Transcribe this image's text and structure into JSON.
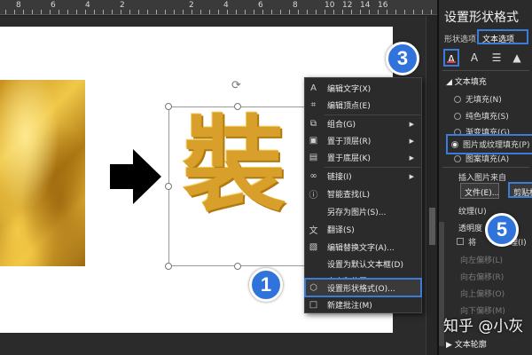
{
  "ruler": {
    "labels": [
      "8",
      "6",
      "4",
      "2",
      "2",
      "4",
      "6",
      "8",
      "10",
      "12",
      "14",
      "16"
    ]
  },
  "colors": {
    "accent": "#3b7bd9",
    "badge": "#2f73db",
    "gold": "#d8a02a"
  },
  "canvas": {
    "text_char": "裝"
  },
  "context_menu": {
    "items": [
      {
        "label": "编辑文字(X)",
        "icon": "edit-text-icon",
        "glyph": "A"
      },
      {
        "label": "编辑顶点(E)",
        "icon": "edit-points-icon",
        "glyph": "⌗"
      },
      {
        "label": "组合(G)",
        "icon": "group-icon",
        "glyph": "⧉",
        "submenu": true
      },
      {
        "label": "置于顶层(R)",
        "icon": "bring-to-front-icon",
        "glyph": "▣",
        "submenu": true
      },
      {
        "label": "置于底层(K)",
        "icon": "send-to-back-icon",
        "glyph": "▤",
        "submenu": true
      },
      {
        "label": "链接(I)",
        "icon": "link-icon",
        "glyph": "∞",
        "submenu": true
      },
      {
        "label": "智能查找(L)",
        "icon": "smart-lookup-icon",
        "glyph": "ⓘ"
      },
      {
        "label": "另存为图片(S)...",
        "icon": "save-as-picture-icon",
        "glyph": ""
      },
      {
        "label": "翻译(S)",
        "icon": "translate-icon",
        "glyph": "文"
      },
      {
        "label": "编辑替换文字(A)...",
        "icon": "alt-text-icon",
        "glyph": "▧"
      },
      {
        "label": "设置为默认文本框(D)",
        "icon": "default-textbox-icon",
        "glyph": ""
      },
      {
        "label": "大小和位置(Z)...",
        "icon": "size-position-icon",
        "glyph": "⌐"
      },
      {
        "label": "设置形状格式(O)...",
        "icon": "format-shape-icon",
        "glyph": "⬡"
      },
      {
        "label": "新建批注(M)",
        "icon": "new-comment-icon",
        "glyph": "□"
      }
    ]
  },
  "badges": [
    "1",
    "3",
    "5"
  ],
  "pane": {
    "title": "设置形状格式",
    "tab_shape": "形状选项",
    "tab_text": "文本选项",
    "icon_tabs": [
      {
        "icon": "text-fill-icon",
        "glyph": "A"
      },
      {
        "icon": "text-effects-icon",
        "glyph": "A"
      },
      {
        "icon": "textbox-icon",
        "glyph": "☰"
      },
      {
        "icon": "picture-icon",
        "glyph": "▲"
      }
    ],
    "section_fill": "文本填充",
    "fill_options": [
      "无填充(N)",
      "纯色填充(S)",
      "渐变填充(G)",
      "图片或纹理填充(P)",
      "图案填充(A)"
    ],
    "fill_selected": "图片或纹理填充(P)",
    "insert_from": "插入图片来自",
    "file_button": "文件(E)...",
    "clipboard_button": "剪贴板",
    "texture": "纹理(U)",
    "transparency": "透明度",
    "tile_label": "将",
    "tile_suffix": "理(I)",
    "offsets": [
      "向左偏移(L)",
      "向右偏移(R)",
      "向上偏移(O)",
      "向下偏移(M)"
    ],
    "section_outline": "文本轮廓"
  },
  "watermark": "知乎 @小灰"
}
